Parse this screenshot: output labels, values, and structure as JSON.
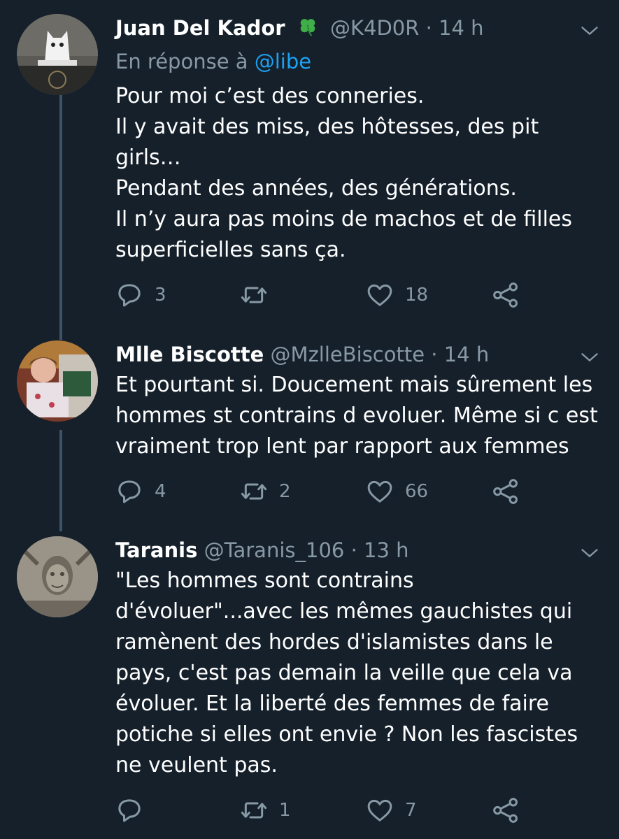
{
  "tweets": [
    {
      "name": "Juan Del Kador",
      "handle": "@K4D0R",
      "time": "14 h",
      "reply_prefix": "En réponse à",
      "reply_user": "@libe",
      "lines": [
        "Pour moi c’est des conneries.",
        "Il y avait des miss, des hôtesses, des pit",
        "girls…",
        "Pendant des années, des générations.",
        "Il n’y aura pas moins de machos et de filles",
        "superficielles sans ça."
      ],
      "replies": "3",
      "retweets": "",
      "likes": "18"
    },
    {
      "name": "Mlle Biscotte",
      "handle": "@MzlleBiscotte",
      "time": "14 h",
      "lines": [
        "Et pourtant si. Doucement mais sûrement les",
        "hommes st contrains d evoluer. Même si c est",
        "vraiment trop lent par rapport aux femmes"
      ],
      "replies": "4",
      "retweets": "2",
      "likes": "66"
    },
    {
      "name": "Taranis",
      "handle": "@Taranis_106",
      "time": "13 h",
      "lines": [
        "\"Les hommes sont contrains",
        "d'évoluer\"...avec les mêmes gauchistes qui",
        "ramènent des hordes d'islamistes dans le",
        "pays, c'est pas demain la veille que cela va",
        "évoluer. Et la liberté des femmes de faire",
        "potiche si elles ont envie ? Non les fascistes",
        "ne veulent pas."
      ],
      "replies": "",
      "retweets": "1",
      "likes": "7"
    }
  ],
  "icons": {
    "badge": "four-leaf-clover-icon",
    "reply": "reply-icon",
    "retweet": "retweet-icon",
    "like": "heart-icon",
    "share": "share-icon",
    "menu": "chevron-down-icon"
  },
  "colors": {
    "background": "#15202b",
    "text": "#ffffff",
    "secondary": "#8899a6",
    "link": "#1da1f2",
    "thread": "#3d5466"
  }
}
